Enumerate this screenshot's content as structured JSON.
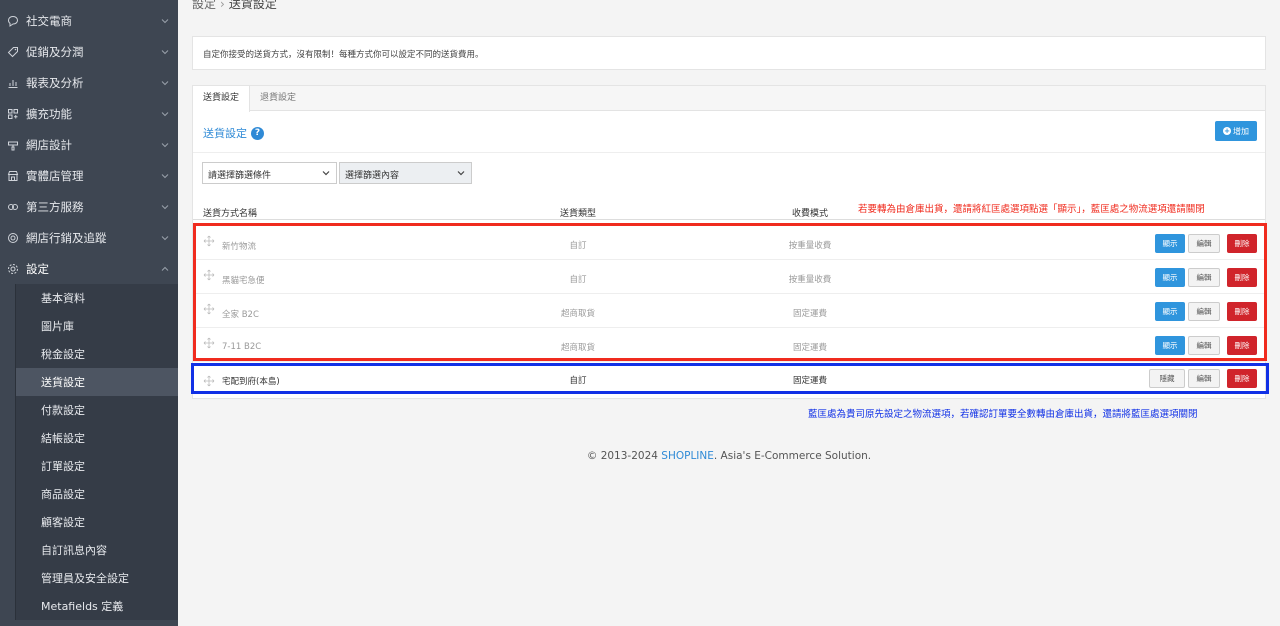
{
  "sidebar": {
    "items": [
      {
        "label": "社交電商",
        "icon": "chat-bubble-icon"
      },
      {
        "label": "促銷及分潤",
        "icon": "tag-icon"
      },
      {
        "label": "報表及分析",
        "icon": "bar-chart-icon"
      },
      {
        "label": "擴充功能",
        "icon": "grid-plus-icon"
      },
      {
        "label": "網店設計",
        "icon": "paint-brush-icon"
      },
      {
        "label": "實體店管理",
        "icon": "store-icon"
      },
      {
        "label": "第三方服務",
        "icon": "handshake-icon"
      },
      {
        "label": "網店行銷及追蹤",
        "icon": "target-icon"
      }
    ],
    "settings": {
      "label": "設定",
      "icon": "gear-icon"
    },
    "sub_items": [
      "基本資料",
      "圖片庫",
      "稅金設定",
      "送貨設定",
      "付款設定",
      "結帳設定",
      "訂單設定",
      "商品設定",
      "顧客設定",
      "自訂訊息內容",
      "管理員及安全設定",
      "Metafields 定義"
    ],
    "active_sub_index": 3
  },
  "breadcrumb": {
    "parent": "設定",
    "separator": "›",
    "current": "送貨設定"
  },
  "info": "自定你接受的送貨方式，沒有限制！每種方式你可以設定不同的送貨費用。",
  "tabs": [
    "送貨設定",
    "退貨設定"
  ],
  "section": {
    "title": "送貨設定",
    "help": "?",
    "add_label": "增加"
  },
  "filters": {
    "condition_placeholder": "請選擇篩選條件",
    "value_placeholder": "選擇篩選內容"
  },
  "table": {
    "headers": {
      "name": "送貨方式名稱",
      "type": "送貨類型",
      "mode": "收費模式"
    },
    "rows": [
      {
        "name": "新竹物流",
        "type": "自訂",
        "mode": "按重量收費",
        "toggle_label": "顯示",
        "edit_label": "編輯",
        "delete_label": "刪除",
        "enabled": false
      },
      {
        "name": "黑貓宅急便",
        "type": "自訂",
        "mode": "按重量收費",
        "toggle_label": "顯示",
        "edit_label": "編輯",
        "delete_label": "刪除",
        "enabled": false
      },
      {
        "name": "全家 B2C",
        "type": "超商取貨",
        "mode": "固定運費",
        "toggle_label": "顯示",
        "edit_label": "編輯",
        "delete_label": "刪除",
        "enabled": false
      },
      {
        "name": "7-11 B2C",
        "type": "超商取貨",
        "mode": "固定運費",
        "toggle_label": "顯示",
        "edit_label": "編輯",
        "delete_label": "刪除",
        "enabled": false
      },
      {
        "name": "宅配到府(本島)",
        "type": "自訂",
        "mode": "固定運費",
        "toggle_label": "隱藏",
        "edit_label": "編輯",
        "delete_label": "刪除",
        "enabled": true
      }
    ]
  },
  "annotations": {
    "red_note": "若要轉為由倉庫出貨，還請將紅匡處選項點選「顯示」，藍匡處之物流選項還請關閉",
    "blue_note": "藍匡處為貴司原先設定之物流選項，若確認訂單要全數轉由倉庫出貨，還請將藍匡處選項關閉",
    "red_color": "#f02b1e",
    "blue_color": "#1131e6"
  },
  "footer": {
    "prefix": "© 2013-2024 ",
    "brand": "SHOPLINE",
    "suffix": ". Asia's E-Commerce Solution."
  }
}
